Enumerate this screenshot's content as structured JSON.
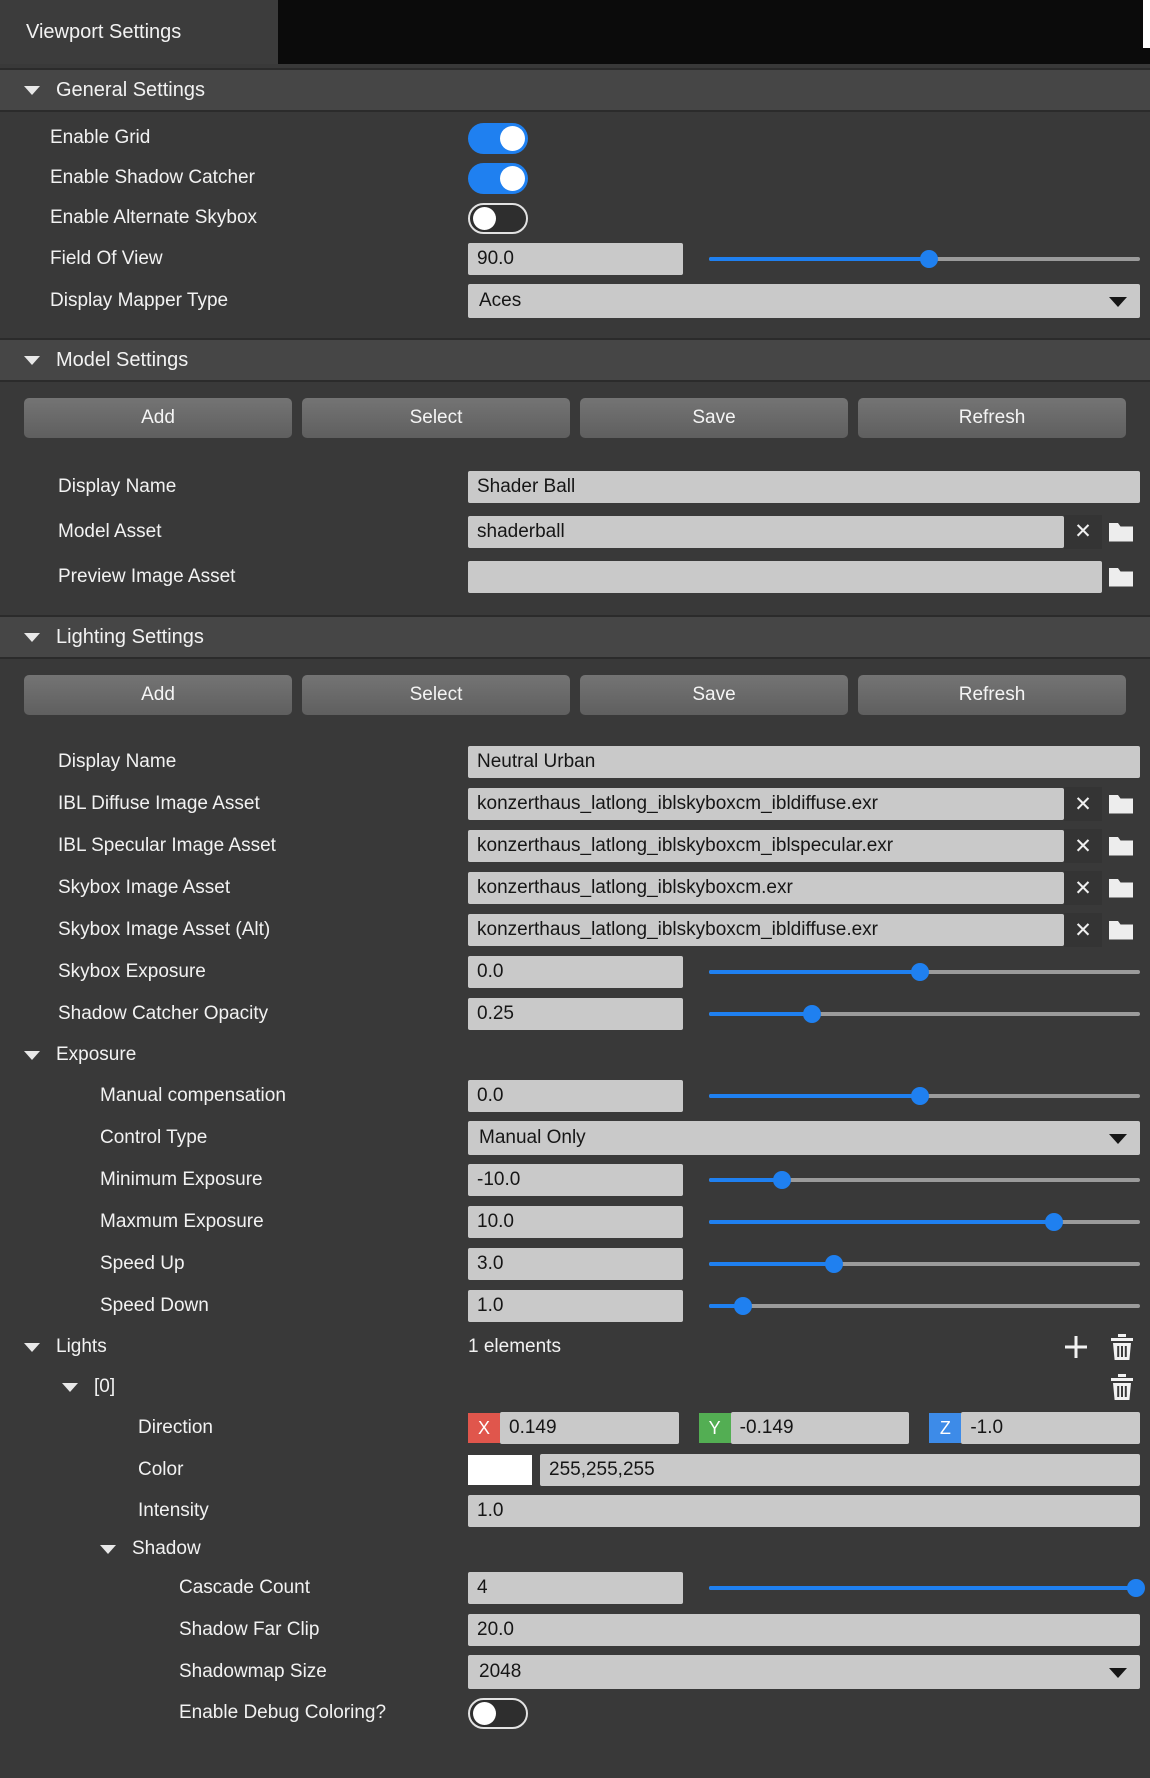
{
  "tab_bar": {
    "active_tab": "Viewport Settings"
  },
  "colors": {
    "accent_blue": "#1f80f0",
    "axis_x_red": "#e0564c",
    "axis_y_green": "#53ae53",
    "axis_z_blue": "#3d8be8",
    "light_color_swatch": "#ffffff"
  },
  "general": {
    "title": "General Settings",
    "enable_grid": {
      "label": "Enable Grid",
      "on": true
    },
    "enable_shadow_catcher": {
      "label": "Enable Shadow Catcher",
      "on": true
    },
    "enable_alternate_skybox": {
      "label": "Enable Alternate Skybox",
      "on": false
    },
    "field_of_view": {
      "label": "Field Of View",
      "value": "90.0",
      "slider_percent": 51
    },
    "display_mapper_type": {
      "label": "Display Mapper Type",
      "value": "Aces"
    }
  },
  "model": {
    "title": "Model Settings",
    "buttons": {
      "add": "Add",
      "select": "Select",
      "save": "Save",
      "refresh": "Refresh"
    },
    "display_name": {
      "label": "Display Name",
      "value": "Shader Ball"
    },
    "model_asset": {
      "label": "Model Asset",
      "value": "shaderball"
    },
    "preview_image_asset": {
      "label": "Preview Image Asset",
      "value": ""
    }
  },
  "lighting": {
    "title": "Lighting Settings",
    "buttons": {
      "add": "Add",
      "select": "Select",
      "save": "Save",
      "refresh": "Refresh"
    },
    "display_name": {
      "label": "Display Name",
      "value": "Neutral Urban"
    },
    "ibl_diffuse_image_asset": {
      "label": "IBL Diffuse Image Asset",
      "value": "konzerthaus_latlong_iblskyboxcm_ibldiffuse.exr"
    },
    "ibl_specular_image_asset": {
      "label": "IBL Specular Image Asset",
      "value": "konzerthaus_latlong_iblskyboxcm_iblspecular.exr"
    },
    "skybox_image_asset": {
      "label": "Skybox Image Asset",
      "value": "konzerthaus_latlong_iblskyboxcm.exr"
    },
    "skybox_image_asset_alt": {
      "label": "Skybox Image Asset (Alt)",
      "value": "konzerthaus_latlong_iblskyboxcm_ibldiffuse.exr"
    },
    "skybox_exposure": {
      "label": "Skybox Exposure",
      "value": "0.0",
      "slider_percent": 49
    },
    "shadow_catcher_opacity": {
      "label": "Shadow Catcher Opacity",
      "value": "0.25",
      "slider_percent": 24
    },
    "exposure": {
      "title": "Exposure",
      "manual_compensation": {
        "label": "Manual compensation",
        "value": "0.0",
        "slider_percent": 49
      },
      "control_type": {
        "label": "Control Type",
        "value": "Manual Only"
      },
      "minimum_exposure": {
        "label": "Minimum Exposure",
        "value": "-10.0",
        "slider_percent": 17
      },
      "maximum_exposure": {
        "label": "Maxmum Exposure",
        "value": "10.0",
        "slider_percent": 80
      },
      "speed_up": {
        "label": "Speed Up",
        "value": "3.0",
        "slider_percent": 29
      },
      "speed_down": {
        "label": "Speed Down",
        "value": "1.0",
        "slider_percent": 8
      }
    },
    "lights": {
      "title": "Lights",
      "count_text": "1 elements",
      "item_0": {
        "title": "[0]",
        "direction": {
          "label": "Direction",
          "x_tag": "X",
          "x_value": "0.149",
          "y_tag": "Y",
          "y_value": "-0.149",
          "z_tag": "Z",
          "z_value": "-1.0"
        },
        "color": {
          "label": "Color",
          "value": "255,255,255"
        },
        "intensity": {
          "label": "Intensity",
          "value": "1.0"
        },
        "shadow": {
          "title": "Shadow",
          "cascade_count": {
            "label": "Cascade Count",
            "value": "4",
            "slider_percent": 99
          },
          "shadow_far_clip": {
            "label": "Shadow Far Clip",
            "value": "20.0"
          },
          "shadowmap_size": {
            "label": "Shadowmap Size",
            "value": "2048"
          },
          "enable_debug_coloring": {
            "label": "Enable Debug Coloring?",
            "on": false
          }
        }
      }
    }
  }
}
